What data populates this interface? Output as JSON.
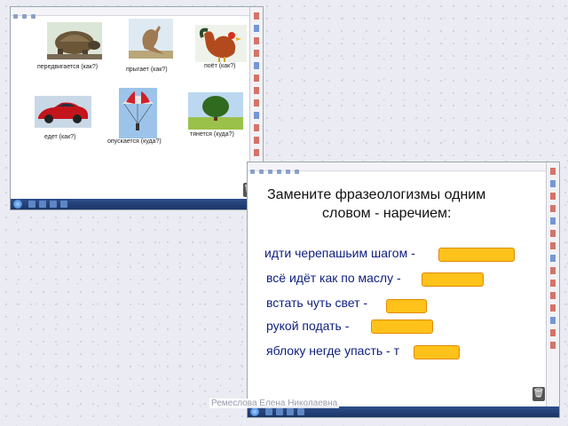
{
  "slide1": {
    "items": [
      {
        "caption": "передвигается (как?)",
        "icon": "turtle-image"
      },
      {
        "caption": "прыгает (как?)",
        "icon": "kangaroo-image"
      },
      {
        "caption": "поёт (как?)",
        "icon": "rooster-image"
      },
      {
        "caption": "едет (как?)",
        "icon": "car-image"
      },
      {
        "caption": "опускается (куда?)",
        "icon": "parachute-image"
      },
      {
        "caption": "тянется (куда?)",
        "icon": "tree-image"
      }
    ]
  },
  "slide2": {
    "title_line1": "Замените фразеологизмы одним",
    "title_line2": "словом - наречием:",
    "phrases": [
      "идти черепашьим шагом - ",
      "всё идёт как по маслу - ",
      "встать чуть свет - ",
      "рукой подать - ",
      "яблоку негде упасть - т"
    ],
    "answer_color": "#ffc21a"
  },
  "watermark": "Ремеслова Елена Николаевна"
}
